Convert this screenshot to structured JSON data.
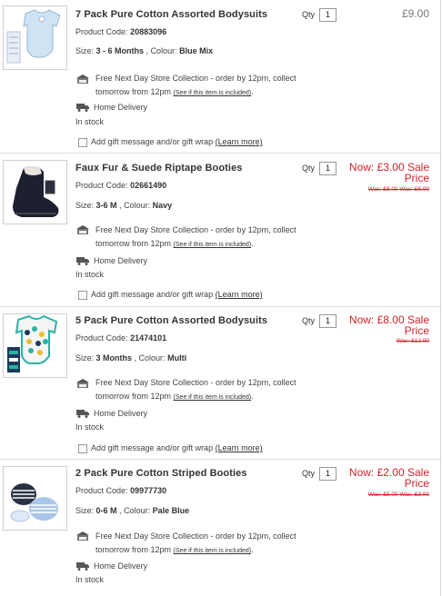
{
  "labels": {
    "product_code": "Product Code:",
    "size": "Size:",
    "colour": "Colour:",
    "qty": "Qty",
    "store_line1": "Free Next Day Store Collection - order by 12pm, collect",
    "store_line2": "tomorrow from 12pm",
    "store_link": "(See if this item is included)",
    "home_delivery": "Home Delivery",
    "in_stock": "In stock",
    "gift_text": "Add gift message and/or gift wrap",
    "learn_more": "(Learn more)",
    "sale_prefix": "Now:",
    "sale_suffix_1": "Sale",
    "sale_suffix_2": "Price"
  },
  "items": [
    {
      "title": "7 Pack Pure Cotton Assorted Bodysuits",
      "code": "20883096",
      "size": "3 - 6 Months",
      "colour": "Blue Mix",
      "qty": "1",
      "price": "£9.00",
      "sale": false,
      "thumb": "bodysuit-blue-thumbnail"
    },
    {
      "title": "Faux Fur & Suede Riptape Booties",
      "code": "02661490",
      "size": "3-6 M",
      "colour": "Navy",
      "qty": "1",
      "now_price": "£3.00",
      "was": "Was: £8.00  Was: £6.00",
      "sale": true,
      "thumb": "navy-booties-thumbnail"
    },
    {
      "title": "5 Pack Pure Cotton Assorted Bodysuits",
      "code": "21474101",
      "size": "3 Months",
      "colour": "Multi",
      "qty": "1",
      "now_price": "£8.00",
      "was": "Was: £12.00",
      "sale": true,
      "thumb": "multi-bodysuit-thumbnail"
    },
    {
      "title": "2 Pack Pure Cotton Striped Booties",
      "code": "09977730",
      "size": "0-6 M",
      "colour": "Pale Blue",
      "qty": "1",
      "now_price": "£2.00",
      "was": "Was: £5.00  Was: £3.00",
      "sale": true,
      "thumb": "striped-booties-thumbnail"
    }
  ]
}
